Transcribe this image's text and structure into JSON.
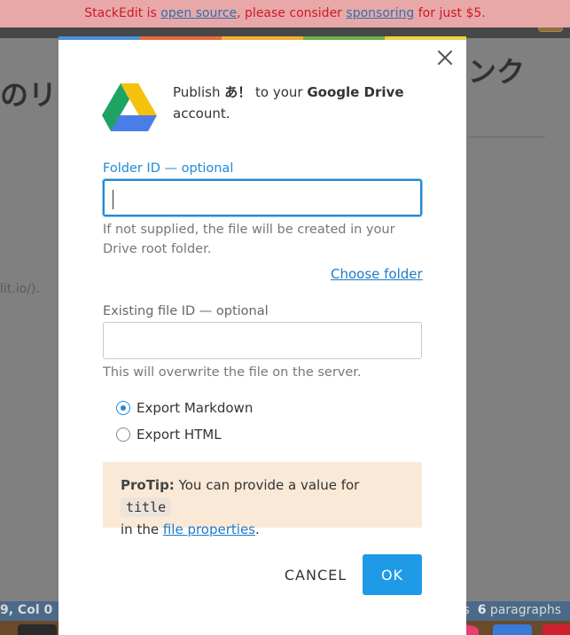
{
  "banner": {
    "prefix": "StackEdit is ",
    "link1": "open source",
    "middle": ", please consider ",
    "link2": "sponsoring",
    "suffix": " for just $5."
  },
  "background": {
    "heading_left": "のリン",
    "heading_right": "ンク",
    "link_fragment": "lit.io/).",
    "status_left": "9, Col 0",
    "status_right_suffix": "s",
    "paragraph_count": "6",
    "paragraph_label": "paragraphs"
  },
  "modal": {
    "publish": {
      "prefix": "Publish ",
      "doc_title": "あ！",
      "middle": " to your ",
      "service": "Google Drive",
      "suffix": " account."
    },
    "folder": {
      "label": "Folder ID — optional",
      "value": "",
      "hint": "If not supplied, the file will be created in your Drive root folder.",
      "choose_label": "Choose folder"
    },
    "file": {
      "label": "Existing file ID — optional",
      "value": "",
      "hint": "This will overwrite the file on the server."
    },
    "format": {
      "options": [
        "Export Markdown",
        "Export HTML"
      ],
      "selected": "Export Markdown"
    },
    "protip": {
      "head": "ProTip:",
      "text1": " You can provide a value for ",
      "code": "title",
      "text2": " in the ",
      "link": "file properties",
      "text3": "."
    },
    "buttons": {
      "cancel": "CANCEL",
      "ok": "OK"
    }
  },
  "colors": {
    "accent": "#1f8ad8",
    "ok_button": "#1f9ae6",
    "protip_bg": "#fae9d6",
    "banner_bg": "#e8a8a8",
    "banner_text": "#d0182c"
  },
  "icons": {
    "close": "close-icon",
    "drive": "google-drive-icon"
  }
}
